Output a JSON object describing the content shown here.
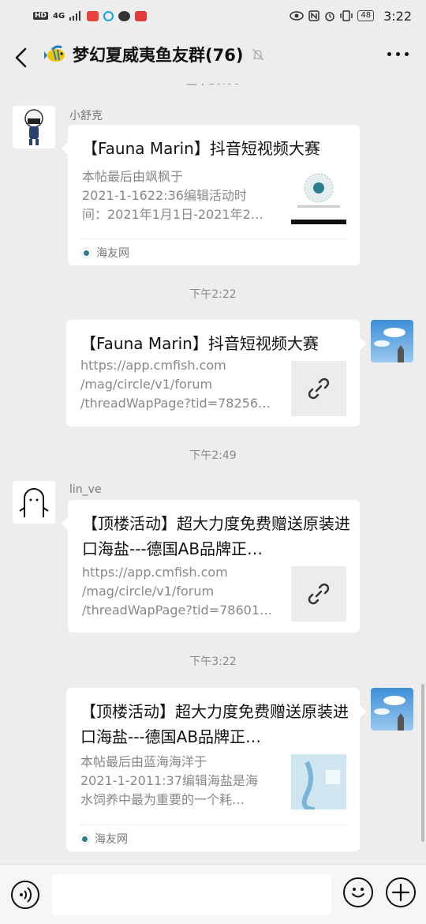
{
  "status_bar": {
    "hd": "HD",
    "network": "4G",
    "battery": "48",
    "time": "3:22"
  },
  "header": {
    "title": "梦幻夏威夷鱼友群(76)",
    "icons": [
      "back-arrow-icon",
      "group-fish-icon",
      "mute-bell-icon",
      "more-dots-icon"
    ]
  },
  "messages": [
    {
      "type": "link_card",
      "sender": "小舒克",
      "title": "【Fauna Marin】抖音短视频大赛",
      "desc": "本帖最后由飒枫于\n2021-1-1622:36编辑活动时\n间：2021年1月1日-2021年2…",
      "source": "海友网"
    },
    {
      "type": "timestamp",
      "text": "下午2:22"
    },
    {
      "type": "link_card",
      "sender": "",
      "title": "【Fauna Marin】抖音短视频大赛",
      "desc": "https://app.cmfish.com\n/mag/circle/v1/forum\n/threadWapPage?tid=78256…"
    },
    {
      "type": "timestamp",
      "text": "下午2:49"
    },
    {
      "type": "link_card",
      "sender": "lin_ve",
      "title": "【顶楼活动】超大力度免费赠送原装进口海盐---德国AB品牌正…",
      "desc": "https://app.cmfish.com\n/mag/circle/v1/forum\n/threadWapPage?tid=78601…"
    },
    {
      "type": "timestamp",
      "text": "下午3:22"
    },
    {
      "type": "link_card",
      "sender": "",
      "title": "【顶楼活动】超大力度免费赠送原装进口海盐---德国AB品牌正…",
      "desc": "本帖最后由蓝海海洋于\n2021-1-2011:37编辑海盐是海\n水饲养中最为重要的一个耗…",
      "source": "海友网"
    }
  ],
  "input_bar": {
    "placeholder": "",
    "icons": [
      "voice-icon",
      "emoji-icon",
      "plus-icon"
    ]
  },
  "colors": {
    "background": "#ededed",
    "card": "#ffffff",
    "timestamp": "#8a8a8a",
    "source_icon": "#2c7c8f"
  }
}
